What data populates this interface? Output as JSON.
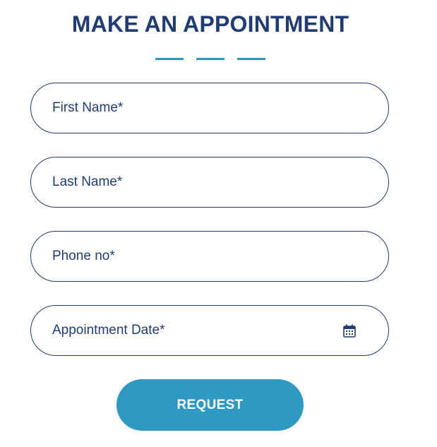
{
  "form": {
    "title": "MAKE AN APPOINTMENT",
    "accent_color": "#2e9ac4",
    "text_color": "#1f3c75",
    "fields": [
      {
        "placeholder": "First Name*"
      },
      {
        "placeholder": "Last Name*"
      },
      {
        "placeholder": "Phone no*"
      },
      {
        "placeholder": "Appointment Date*",
        "icon": "calendar-icon"
      }
    ],
    "submit_label": "REQUEST"
  }
}
